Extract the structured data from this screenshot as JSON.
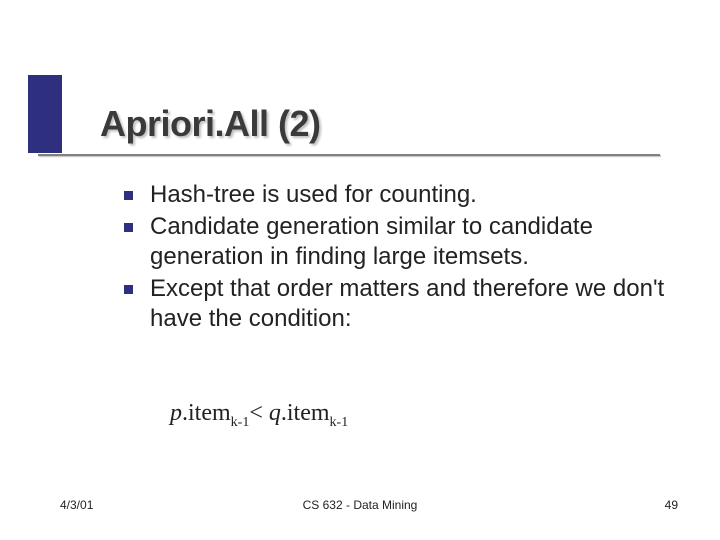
{
  "title": "Apriori.All (2)",
  "bullets": [
    "Hash-tree is used for counting.",
    "Candidate generation similar to candidate generation in finding large itemsets.",
    "Except that order matters and therefore we don't have the condition:"
  ],
  "formula": {
    "p_var": "p",
    "p_field": ".item",
    "p_sub": "k-1",
    "lt": "< ",
    "q_var": "q",
    "q_field": ".item",
    "q_sub": "k-1"
  },
  "footer": {
    "date": "4/3/01",
    "course": "CS 632 - Data Mining",
    "page": "49"
  }
}
